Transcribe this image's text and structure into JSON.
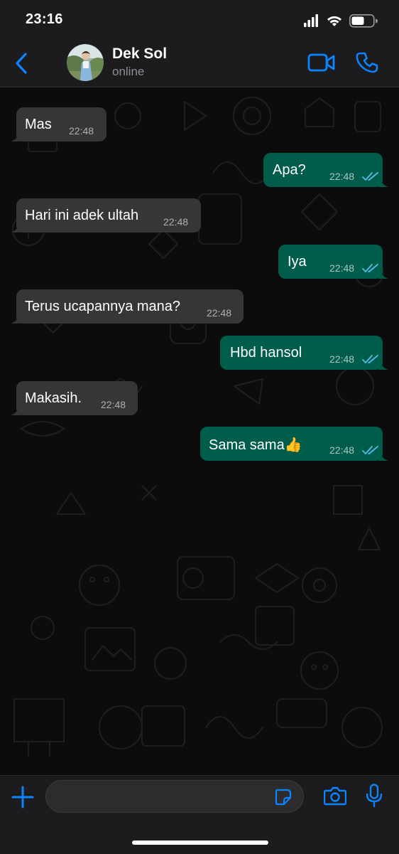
{
  "status_bar": {
    "time": "23:16"
  },
  "header": {
    "contact_name": "Dek Sol",
    "contact_status": "online"
  },
  "messages": [
    {
      "direction": "incoming",
      "text": "Mas",
      "time": "22:48"
    },
    {
      "direction": "outgoing",
      "text": "Apa?",
      "time": "22:48",
      "read": true
    },
    {
      "direction": "incoming",
      "text": "Hari ini adek ultah",
      "time": "22:48"
    },
    {
      "direction": "outgoing",
      "text": "Iya",
      "time": "22:48",
      "read": true
    },
    {
      "direction": "incoming",
      "text": "Terus ucapannya mana?",
      "time": "22:48"
    },
    {
      "direction": "outgoing",
      "text": "Hbd hansol",
      "time": "22:48",
      "read": true
    },
    {
      "direction": "incoming",
      "text": "Makasih.",
      "time": "22:48"
    },
    {
      "direction": "outgoing",
      "text": "Sama sama👍",
      "time": "22:48",
      "read": true
    }
  ],
  "input_bar": {
    "placeholder": ""
  },
  "colors": {
    "accent": "#0a84ff",
    "incoming_bubble": "#363638",
    "outgoing_bubble": "#005c4b",
    "read_ticks": "#53bdeb",
    "bar_background": "#1c1c1e"
  },
  "icons": [
    "signal-icon",
    "wifi-icon",
    "battery-icon",
    "back-chevron-icon",
    "video-call-icon",
    "phone-icon",
    "plus-icon",
    "sticker-icon",
    "camera-icon",
    "microphone-icon",
    "read-receipt-icon"
  ]
}
